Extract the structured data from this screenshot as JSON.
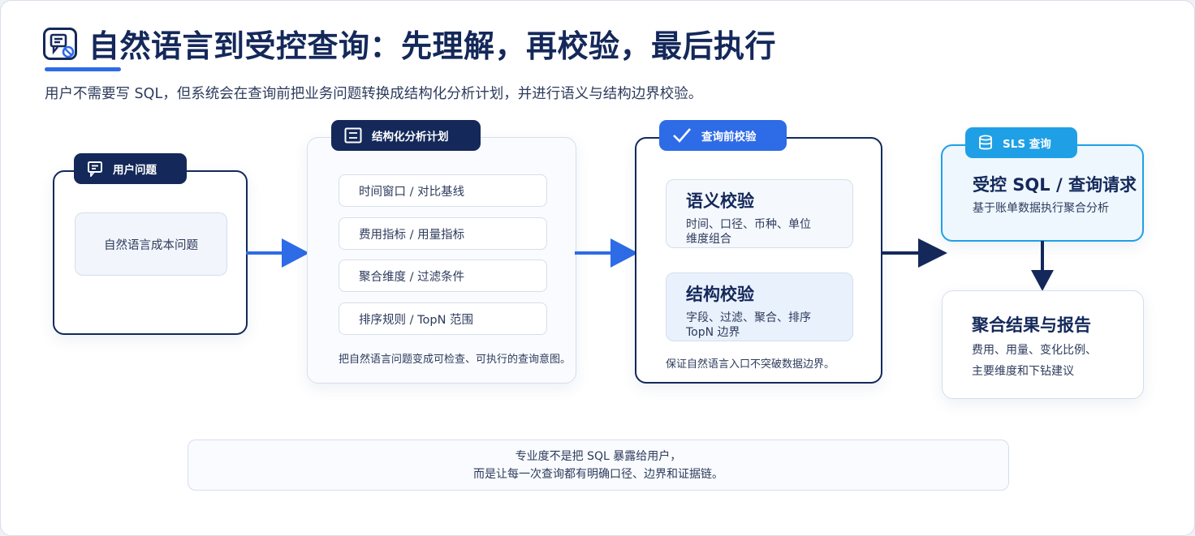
{
  "header": {
    "title": "自然语言到受控查询：先理解，再校验，最后执行",
    "subtitle": "用户不需要写 SQL，但系统会在查询前把业务问题转换成结构化分析计划，并进行语义与结构边界校验。"
  },
  "steps": {
    "user_question": {
      "tag": "用户问题",
      "content": "自然语言成本问题"
    },
    "structured_plan": {
      "tag": "结构化分析计划",
      "items": [
        "时间窗口 / 对比基线",
        "费用指标 / 用量指标",
        "聚合维度 / 过滤条件",
        "排序规则 / TopN 范围"
      ],
      "note": "把自然语言问题变成可检查、可执行的查询意图。"
    },
    "pre_query_check": {
      "tag": "查询前校验",
      "semantic": {
        "title": "语义校验",
        "desc_line1": "时间、口径、币种、单位",
        "desc_line2": "维度组合"
      },
      "structural": {
        "title": "结构校验",
        "desc_line1": "字段、过滤、聚合、排序",
        "desc_line2": "TopN 边界"
      },
      "note": "保证自然语言入口不突破数据边界。"
    },
    "sls_query": {
      "tag": "SLS 查询",
      "title": "受控 SQL / 查询请求",
      "desc": "基于账单数据执行聚合分析"
    },
    "result": {
      "title": "聚合结果与报告",
      "desc_line1": "费用、用量、变化比例、",
      "desc_line2": "主要维度和下钻建议"
    }
  },
  "footer": {
    "line1": "专业度不是把 SQL 暴露给用户，",
    "line2": "而是让每一次查询都有明确口径、边界和证据链。"
  },
  "icons": {
    "title": "feedback-form-icon",
    "user_question": "message-icon",
    "structured_plan": "list-icon",
    "pre_query_check": "check-icon",
    "sls_query": "database-icon"
  },
  "colors": {
    "navy": "#14285a",
    "blue": "#2e6be6",
    "cyan": "#1fa0e6"
  }
}
